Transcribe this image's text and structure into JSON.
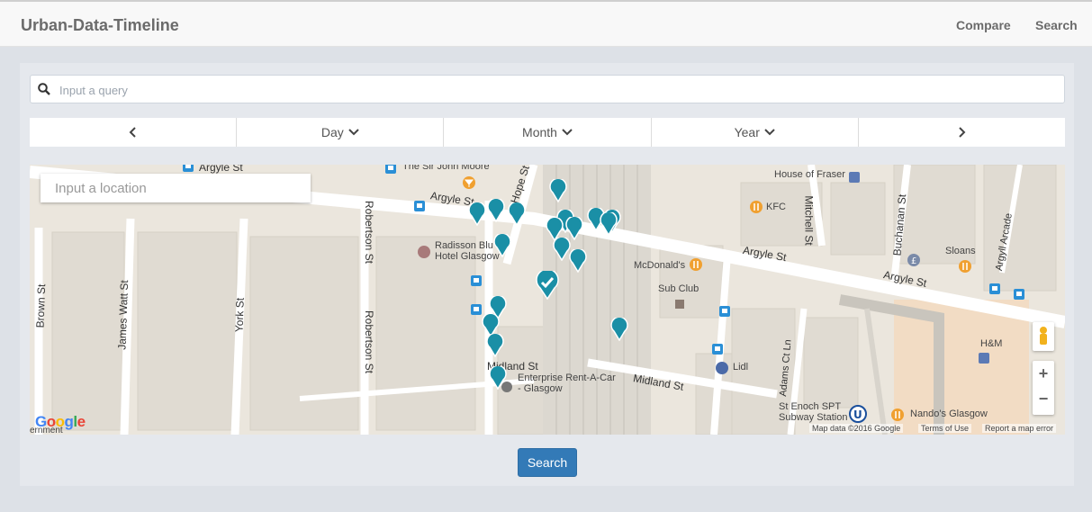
{
  "navbar": {
    "brand": "Urban-Data-Timeline",
    "links": [
      "Compare",
      "Search"
    ]
  },
  "query": {
    "placeholder": "Input a query"
  },
  "datebar": {
    "prev_icon": "chevron-left",
    "day": "Day",
    "month": "Month",
    "year": "Year",
    "next_icon": "chevron-right"
  },
  "map": {
    "location_placeholder": "Input a location",
    "streets": [
      "Argyle St",
      "Argyle St",
      "Argyle St",
      "Argyle St",
      "Hope St",
      "Robertson St",
      "Robertson St",
      "York St",
      "James Watt St",
      "Brown St",
      "Midland St",
      "Midland St",
      "Mitchell St",
      "Buchanan St",
      "Argyll Arcade",
      "Adams Ct Ln"
    ],
    "places": [
      "The Sir John Moore",
      "Radisson Blu Hotel Glasgow",
      "House of Fraser",
      "KFC",
      "Sloans",
      "McDonald's",
      "Sub Club",
      "Lidl",
      "H&M",
      "Enterprise Rent-A-Car - Glasgow",
      "St Enoch SPT Subway Station",
      "Nando's Glasgow",
      "ernment"
    ],
    "google_logo": "Google",
    "attribution": [
      "Map data ©2016 Google",
      "Terms of Use",
      "Report a map error"
    ],
    "zoom": [
      "+",
      "−"
    ],
    "marker_color": "#1a8fa6"
  },
  "search_button": "Search"
}
